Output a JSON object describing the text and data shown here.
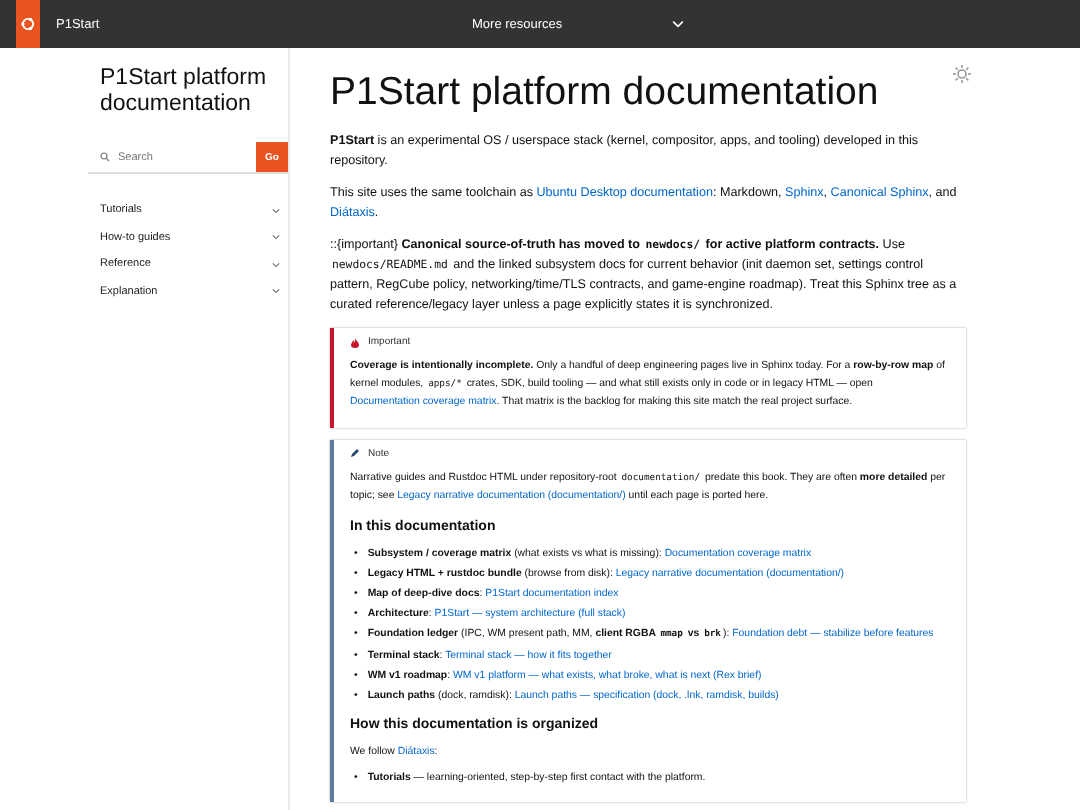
{
  "topbar": {
    "brand": "P1Start",
    "menu": "More resources"
  },
  "sidebar": {
    "title": "P1Start platform documentation",
    "search": {
      "placeholder": "Search",
      "button": "Go"
    },
    "items": [
      "Tutorials",
      "How-to guides",
      "Reference",
      "Explanation"
    ]
  },
  "main": {
    "title": "P1Start platform documentation",
    "paragraphs": [
      [
        {
          "text": "P1Start",
          "kind": "bold"
        },
        {
          "text": " is an experimental OS / userspace stack (kernel, compositor, apps, and tooling) developed in this repository.",
          "kind": "plain"
        }
      ],
      [
        {
          "text": "This site uses the same toolchain as ",
          "kind": "plain"
        },
        {
          "text": "Ubuntu Desktop documentation",
          "kind": "link"
        },
        {
          "text": ": Markdown, ",
          "kind": "plain"
        },
        {
          "text": "Sphinx",
          "kind": "link"
        },
        {
          "text": ", ",
          "kind": "plain"
        },
        {
          "text": "Canonical Sphinx",
          "kind": "link"
        },
        {
          "text": ", and ",
          "kind": "plain"
        },
        {
          "text": "Diátaxis",
          "kind": "link"
        },
        {
          "text": ".",
          "kind": "plain"
        }
      ],
      [
        {
          "text": "::{important} ",
          "kind": "plain"
        },
        {
          "text": "Canonical source-of-truth has moved to ",
          "kind": "bold"
        },
        {
          "text": "newdocs/",
          "kind": "boldcode"
        },
        {
          "text": " for active platform contracts.",
          "kind": "bold"
        },
        {
          "text": " Use ",
          "kind": "plain"
        },
        {
          "text": "newdocs/README.md",
          "kind": "code"
        },
        {
          "text": " and the linked subsystem docs for current behavior (init daemon set, settings control pattern, RegCube policy, networking/time/TLS contracts, and game-engine roadmap). Treat this Sphinx tree as a curated reference/legacy layer unless a page explicitly states it is synchronized.",
          "kind": "plain"
        }
      ]
    ],
    "admonitions": [
      {
        "kind": "important",
        "title": "Important",
        "blocks": [
          {
            "kind": "paragraph",
            "segments": [
              {
                "text": "Coverage is intentionally incomplete.",
                "kind": "bold"
              },
              {
                "text": " Only a handful of deep engineering pages live in Sphinx today. For a ",
                "kind": "plain"
              },
              {
                "text": "row-by-row map",
                "kind": "bold"
              },
              {
                "text": " of kernel modules, ",
                "kind": "plain"
              },
              {
                "text": "apps/*",
                "kind": "code"
              },
              {
                "text": " crates, SDK, build tooling — and what still exists only in code or in legacy HTML — open ",
                "kind": "plain"
              },
              {
                "text": "Documentation coverage matrix",
                "kind": "link"
              },
              {
                "text": ". That matrix is the backlog for making this site match the real project surface.",
                "kind": "plain"
              }
            ]
          }
        ]
      },
      {
        "kind": "note",
        "title": "Note",
        "blocks": [
          {
            "kind": "paragraph",
            "segments": [
              {
                "text": "Narrative guides and Rustdoc HTML under repository-root ",
                "kind": "plain"
              },
              {
                "text": "documentation/",
                "kind": "code"
              },
              {
                "text": " predate this book. They are often ",
                "kind": "plain"
              },
              {
                "text": "more detailed",
                "kind": "bold"
              },
              {
                "text": " per topic; see ",
                "kind": "plain"
              },
              {
                "text": "Legacy narrative documentation (documentation/)",
                "kind": "link"
              },
              {
                "text": " until each page is ported here.",
                "kind": "plain"
              }
            ]
          },
          {
            "kind": "heading",
            "text": "In this documentation"
          },
          {
            "kind": "list",
            "bullet": "•",
            "items": [
              [
                {
                  "text": "Subsystem / coverage matrix",
                  "kind": "bold"
                },
                {
                  "text": " (what exists vs what is missing): ",
                  "kind": "plain"
                },
                {
                  "text": "Documentation coverage matrix",
                  "kind": "link"
                }
              ],
              [
                {
                  "text": "Legacy HTML + rustdoc bundle",
                  "kind": "bold"
                },
                {
                  "text": " (browse from disk): ",
                  "kind": "plain"
                },
                {
                  "text": "Legacy narrative documentation (documentation/)",
                  "kind": "link"
                }
              ],
              [
                {
                  "text": "Map of deep-dive docs",
                  "kind": "bold"
                },
                {
                  "text": ": ",
                  "kind": "plain"
                },
                {
                  "text": "P1Start documentation index",
                  "kind": "link"
                }
              ],
              [
                {
                  "text": "Architecture",
                  "kind": "bold"
                },
                {
                  "text": ": ",
                  "kind": "plain"
                },
                {
                  "text": "P1Start — system architecture (full stack)",
                  "kind": "link"
                }
              ],
              [
                {
                  "text": "Foundation ledger",
                  "kind": "bold"
                },
                {
                  "text": " (IPC, WM present path, MM, ",
                  "kind": "plain"
                },
                {
                  "text": "client RGBA ",
                  "kind": "bold"
                },
                {
                  "text": "mmap",
                  "kind": "boldcode"
                },
                {
                  "text": " vs ",
                  "kind": "bold"
                },
                {
                  "text": "brk",
                  "kind": "boldcode"
                },
                {
                  "text": "): ",
                  "kind": "plain"
                },
                {
                  "text": "Foundation debt — stabilize before features",
                  "kind": "link"
                }
              ],
              [
                {
                  "text": "Terminal stack",
                  "kind": "bold"
                },
                {
                  "text": ": ",
                  "kind": "plain"
                },
                {
                  "text": "Terminal stack — how it fits together",
                  "kind": "link"
                }
              ],
              [
                {
                  "text": "WM v1 roadmap",
                  "kind": "bold"
                },
                {
                  "text": ": ",
                  "kind": "plain"
                },
                {
                  "text": "WM v1 platform — what exists, what broke, what is next (Rex brief)",
                  "kind": "link"
                }
              ],
              [
                {
                  "text": "Launch paths",
                  "kind": "bold"
                },
                {
                  "text": " (dock, ramdisk): ",
                  "kind": "plain"
                },
                {
                  "text": "Launch paths — specification (dock, .lnk, ramdisk, builds)",
                  "kind": "link"
                }
              ]
            ]
          },
          {
            "kind": "heading",
            "text": "How this documentation is organized"
          },
          {
            "kind": "paragraph",
            "segments": [
              {
                "text": "We follow ",
                "kind": "plain"
              },
              {
                "text": "Diátaxis",
                "kind": "link"
              },
              {
                "text": ":",
                "kind": "plain"
              }
            ]
          },
          {
            "kind": "list",
            "bullet": "•",
            "items": [
              [
                {
                  "text": "Tutorials",
                  "kind": "bold"
                },
                {
                  "text": " — learning-oriented, step-by-step first contact with the platform.",
                  "kind": "plain"
                }
              ]
            ]
          }
        ]
      }
    ]
  }
}
